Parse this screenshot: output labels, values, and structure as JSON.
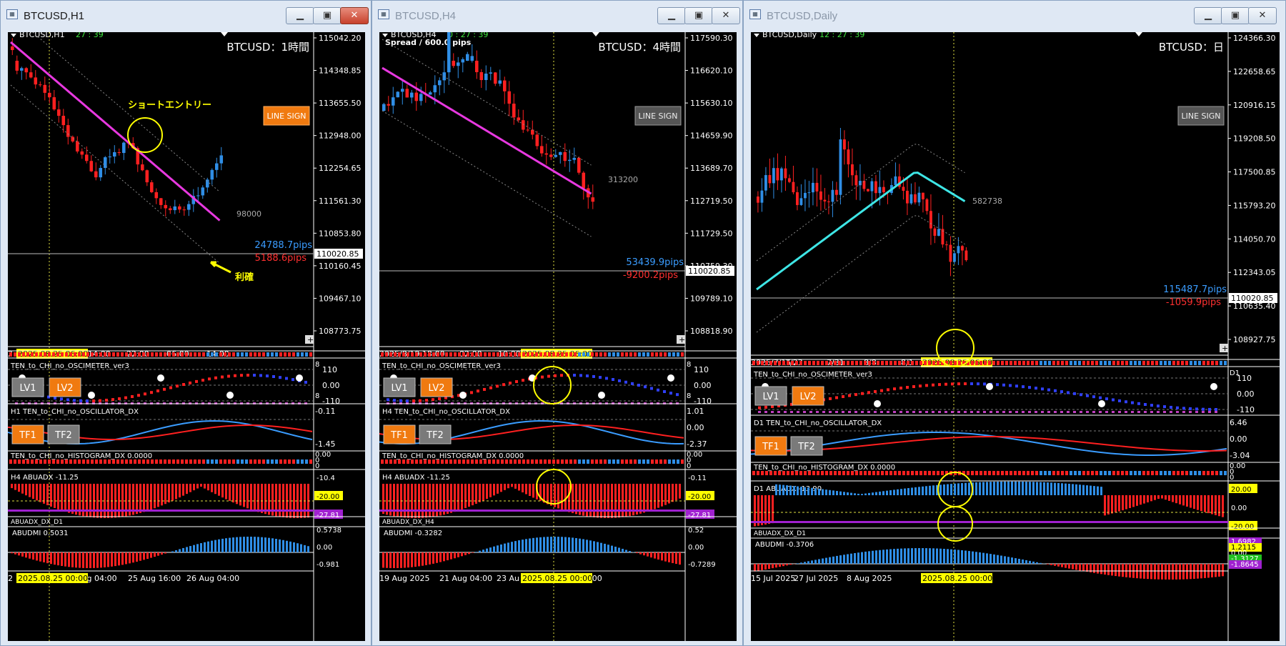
{
  "windows": [
    {
      "title": "BTCUSD,H1",
      "active": true,
      "symbol_label": "BTCUSD,H1",
      "timer": "27 : 39",
      "heading": "BTCUSD：1時間",
      "line_sign_label": "LINE SIGN",
      "price_scale": [
        "115042.20",
        "114348.85",
        "113655.50",
        "112948.00",
        "112254.65",
        "111561.30",
        "110853.80",
        "110160.45",
        "109467.10",
        "108773.75"
      ],
      "current_price": "110020.85",
      "pips_up": "24788.7pips",
      "pips_down": "5188.6pips",
      "band_value": "98000",
      "annotation_entry": "ショートエントリー",
      "annotation_exit": "利確",
      "time_axis": [
        "2",
        "14:00",
        "22:00",
        "06:00",
        "14:00"
      ],
      "time_tag": "2025.08.25 06:00",
      "osc_title": "TEN_to_CHI_no_OSCIMETER_ver3",
      "osc_scale": [
        "110",
        "0.00",
        "-110"
      ],
      "osc_side": [
        "8",
        "8"
      ],
      "lv_buttons": [
        "LV1",
        "LV2"
      ],
      "oscillator_dx_title": "H1 TEN_to_CHI_no_OSCILLATOR_DX",
      "oscillator_dx_scale": [
        "-0.11",
        "-1.45"
      ],
      "tf_buttons": [
        "TF1",
        "TF2"
      ],
      "histogram_title": "TEN_to_CHI_no_HISTOGRAM_DX 0.0000",
      "histogram_scale": [
        "0.00",
        "0",
        "0"
      ],
      "abuadx_title": "H4 ABUADX -11.25",
      "abuadx_scale": [
        "-10.4",
        "-20.00",
        "-27.81"
      ],
      "abuadx_sub": "ABUADX_DX_D1",
      "abudmi_title": "ABUDMI 0.5031",
      "abudmi_scale": [
        "0.5738",
        "0.00",
        "-0.981"
      ],
      "bottom_axis": [
        "2",
        "Aug 04:00",
        "25 Aug 16:00",
        "26 Aug 04:00"
      ],
      "bottom_tag": "2025.08.25 00:00"
    },
    {
      "title": "BTCUSD,H4",
      "active": false,
      "symbol_label": "BTCUSD,H4",
      "timer": "0 : 27 : 39",
      "spread": "Spread / 600.0 pips",
      "heading": "BTCUSD：4時間",
      "line_sign_label": "LINE SIGN",
      "price_scale": [
        "117590.30",
        "116620.10",
        "115630.10",
        "114659.90",
        "113689.70",
        "112719.50",
        "111729.50",
        "110759.30",
        "109789.10",
        "108818.90"
      ],
      "current_price": "110020.85",
      "pips_up": "53439.9pips",
      "pips_down": "-9200.2pips",
      "band_value": "313200",
      "time_axis": [
        "2025/8/19 18:00",
        "02:00",
        "10:00",
        ":00"
      ],
      "time_tag": "2025.08.25 06:00",
      "osc_title": "TEN_to_CHI_no_OSCIMETER_ver3",
      "osc_scale": [
        "110",
        "0.00",
        "-110"
      ],
      "osc_side": [
        "8",
        "8"
      ],
      "lv_buttons": [
        "LV1",
        "LV2"
      ],
      "oscillator_dx_title": "H4 TEN_to_CHI_no_OSCILLATOR_DX",
      "oscillator_dx_scale": [
        "1.01",
        "0.00",
        "-2.37"
      ],
      "tf_buttons": [
        "TF1",
        "TF2"
      ],
      "histogram_title": "TEN_to_CHI_no_HISTOGRAM_DX 0.0000",
      "histogram_scale": [
        "0.00",
        "0",
        "0"
      ],
      "abuadx_title": "H4 ABUADX -11.25",
      "abuadx_scale": [
        "-0.11",
        "-20.00",
        "-27.81"
      ],
      "abuadx_sub": "ABUADX_DX_H4",
      "abudmi_title": "ABUDMI -0.3282",
      "abudmi_scale": [
        "0.52",
        "0.00",
        "-0.7289"
      ],
      "bottom_axis": [
        "19 Aug 2025",
        "21 Aug 04:00",
        "23 Au",
        "04:00"
      ],
      "bottom_tag": "2025.08.25 00:00"
    },
    {
      "title": "BTCUSD,Daily",
      "active": false,
      "symbol_label": "BTCUSD,Daily",
      "timer": "12 : 27 : 39",
      "heading": "BTCUSD：日",
      "line_sign_label": "LINE SIGN",
      "price_scale": [
        "124366.30",
        "122658.65",
        "120916.15",
        "119208.50",
        "117500.85",
        "115793.20",
        "114050.70",
        "112343.05",
        "110635.40",
        "108927.75"
      ],
      "current_price": "110020.85",
      "pips_up": "115487.7pips",
      "pips_down": "-1059.9pips",
      "band_value": "582738",
      "time_axis": [
        "2025/7/15",
        "7/23",
        "7/31",
        "8/8",
        "8/1"
      ],
      "time_tag": "2025.08.25 06:00",
      "osc_title": "TEN_to_CHI_no_OSCIMETER_ver3",
      "osc_scale": [
        "110",
        "0.00",
        "-110"
      ],
      "osc_side": [
        "D1"
      ],
      "lv_buttons": [
        "LV1",
        "LV2"
      ],
      "oscillator_dx_title": "D1 TEN_to_CHI_no_OSCILLATOR_DX",
      "oscillator_dx_scale": [
        "6.46",
        "0.00",
        "-3.04"
      ],
      "tf_buttons": [
        "TF1",
        "TF2"
      ],
      "histogram_title": "TEN_to_CHI_no_HISTOGRAM_DX 0.0000",
      "histogram_scale": [
        "0.00",
        "0",
        "0"
      ],
      "abuadx_title": "D1 ABUADX -13.90",
      "abuadx_scale": [
        "20.00",
        "0.00",
        "-20.00"
      ],
      "abuadx_sub": "ABUADX_DX_D1",
      "abudmi_title": "ABUDMI -0.3706",
      "abudmi_scale": [
        "1.6982",
        "1.2115",
        "0.00",
        "-1.3127",
        "-1.8645"
      ],
      "bottom_axis": [
        "15 Jul 2025",
        "27 Jul 2025",
        "8 Aug 2025"
      ],
      "bottom_tag": "2025.08.25 00:00"
    }
  ],
  "colors": {
    "bull": "#2f8ee6",
    "bear": "#ff2020",
    "ma_magenta": "#e838e0",
    "ma_cyan": "#3ee6e6",
    "highlight_yellow": "#ffff00",
    "button_orange": "#f07a10",
    "button_gray": "#7a7a7a",
    "adx_purple": "#a020d0",
    "green_marker": "#20e020",
    "window_frame": "#dfe8f4"
  },
  "icons": [
    "window-chart-icon",
    "minimize-icon",
    "maximize-icon",
    "close-icon",
    "dropdown-triangle-icon",
    "zoom-plus-icon"
  ]
}
